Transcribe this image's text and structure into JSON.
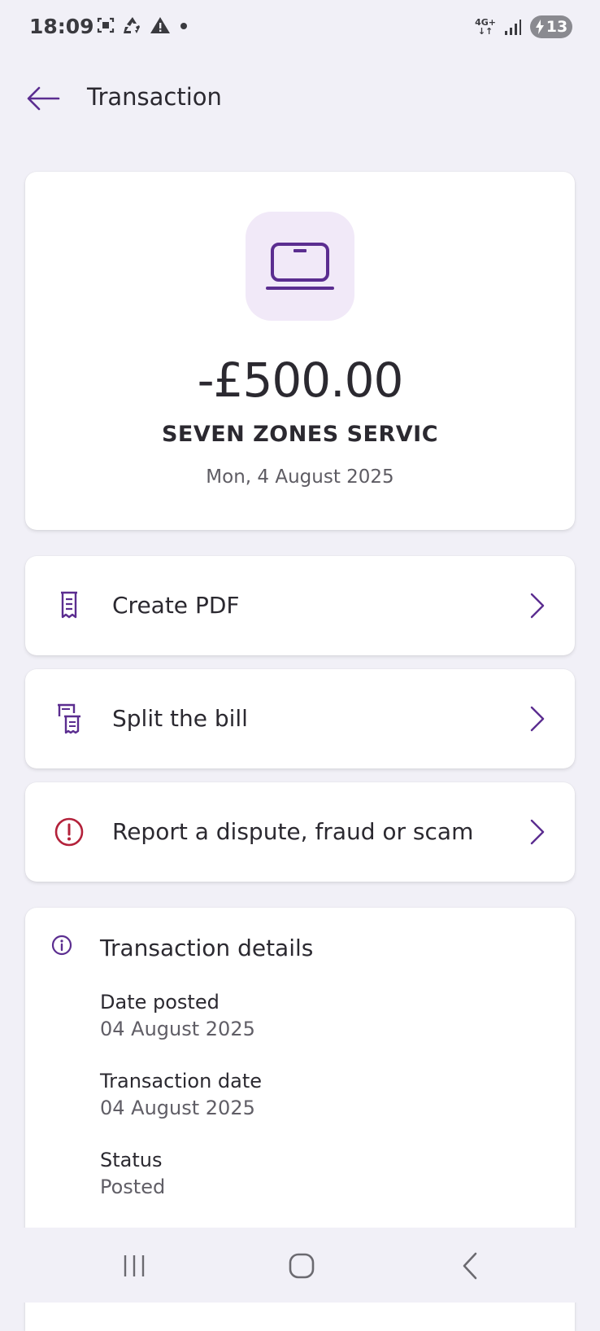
{
  "status_bar": {
    "time": "18:09",
    "network": "4G+",
    "battery": "13",
    "icons_left": [
      "screenshot-icon",
      "recycle-icon",
      "warning-icon",
      "dot-icon"
    ],
    "icons_right": [
      "network-icon",
      "signal-icon",
      "battery-charging-icon"
    ]
  },
  "header": {
    "title": "Transaction",
    "back_icon": "arrow-left-icon"
  },
  "summary": {
    "icon": "laptop-icon",
    "amount": "-£500.00",
    "merchant": "SEVEN ZONES SERVIC",
    "date": "Mon, 4 August 2025"
  },
  "actions": [
    {
      "label": "Create PDF",
      "icon": "receipt-icon"
    },
    {
      "label": "Split the bill",
      "icon": "split-receipt-icon"
    },
    {
      "label": "Report a dispute, fraud or scam",
      "icon": "alert-circle-icon"
    }
  ],
  "details": {
    "title": "Transaction details",
    "icon": "info-icon",
    "rows": [
      {
        "label": "Date posted",
        "value": "04 August 2025"
      },
      {
        "label": "Transaction date",
        "value": "04 August 2025"
      },
      {
        "label": "Status",
        "value": "Posted"
      }
    ]
  },
  "colors": {
    "accent": "#5b2d90",
    "background": "#f1f0f7",
    "alert": "#b3213a",
    "icon_tile": "#f1e9f8"
  },
  "nav_bar": {
    "icons": [
      "recent-apps-icon",
      "home-icon",
      "back-icon"
    ]
  }
}
